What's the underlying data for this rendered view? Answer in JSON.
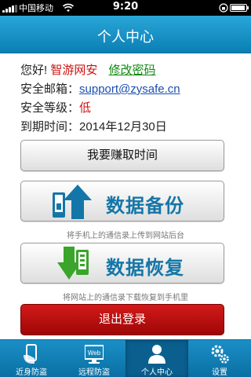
{
  "status_bar": {
    "carrier": "中国移动",
    "time": "9:20"
  },
  "header": {
    "title": "个人中心"
  },
  "profile": {
    "greeting": "您好!",
    "username": "智游网安",
    "change_password": "修改密码",
    "email_label": "安全邮箱：",
    "email": "support@zysafe.cn",
    "level_label": "安全等级：",
    "level": "低",
    "expiry_label": "到期时间：",
    "expiry": "2014年12月30日"
  },
  "actions": {
    "earn_time": "我要赚取时间",
    "backup": "数据备份",
    "backup_caption": "将手机上的通信录上传到网站后台",
    "restore": "数据恢复",
    "restore_caption": "将网站上的通信录下载恢复到手机里",
    "logout": "退出登录"
  },
  "tabs": [
    {
      "label": "近身防盗",
      "icon": "phone-hand-icon"
    },
    {
      "label": "远程防盗",
      "icon": "web-monitor-icon"
    },
    {
      "label": "个人中心",
      "icon": "user-icon"
    },
    {
      "label": "设置",
      "icon": "gears-icon"
    }
  ],
  "active_tab": "个人中心",
  "colors": {
    "header": "#1a8fc8",
    "accent_red": "#cc1111",
    "link_green": "#118811",
    "link_blue": "#1a4fb0",
    "logout": "#c00d0d"
  }
}
